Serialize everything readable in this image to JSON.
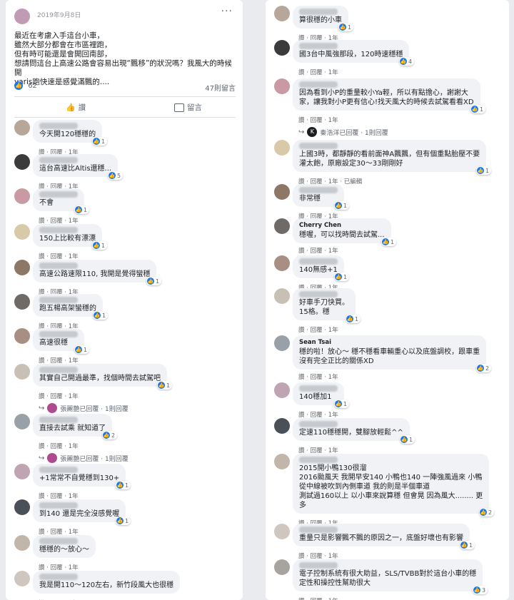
{
  "post": {
    "date": "2019年9月8日",
    "more": "···",
    "body": "最近在考慮入手這台小車，\n雖然大部分都會在市區裡跑，\n但有時可能還是會開回南部，\n想請問這台上高速公路會容易出現“飄移”的狀況嗎？我風大的時候開\nyaris跑快速是感覺滿飄的....",
    "like_count": "62",
    "comment_count": "47則留言",
    "actions": {
      "like": "讚",
      "comment": "留言"
    }
  },
  "colors": {
    "like_blue": "#1877f2",
    "bubble": "#f0f2f5",
    "page_bg": "#e9ebee"
  },
  "icons": {
    "like": "thumb-up-icon",
    "comment": "speech-bubble-icon",
    "more": "ellipsis-icon",
    "reply": "reply-arrow-icon"
  },
  "meta": {
    "like": "讚",
    "reply": "回覆",
    "time": "1年",
    "edited": "已編輯"
  },
  "left_comments": [
    {
      "text": "今天開120穩穩的",
      "reactions": "1"
    },
    {
      "text": "這台高速比Altis還穩...",
      "reactions": "5"
    },
    {
      "text": "不會",
      "reactions": "1"
    },
    {
      "text": "150上比較有漂漂",
      "reactions": "1"
    },
    {
      "text": "高速公路速限110, 我開是覺得蠻穩",
      "reactions": "1"
    },
    {
      "text": "跑五楊高架蠻穩的",
      "reactions": "1"
    },
    {
      "text": "高速很穩",
      "reactions": "1"
    },
    {
      "text": "其實自己開過最準，找個時間去試駕吧",
      "reactions": "1",
      "reply": "張麗艷已回覆 · 1則回覆"
    },
    {
      "text": "直接去試乘 就知道了",
      "reactions": "2",
      "reply": "張麗艷已回覆 · 1則回覆"
    },
    {
      "text": "+1常常不自覺穩到130+",
      "reactions": "1"
    },
    {
      "text": "到140 還是完全沒感覺喔",
      "reactions": "1"
    },
    {
      "text": "穩穩的～放心～",
      "reactions": ""
    },
    {
      "text": "我是開110～120左右，新竹段風大也很穩",
      "reactions": ""
    }
  ],
  "right_comments": [
    {
      "text": "算很穩的小車",
      "reactions": "1"
    },
    {
      "text": "國3台中風強那段，120時速穩穩",
      "reactions": "4"
    },
    {
      "text": "因為看到小P的重量較小Ya輕，所以有點擔心，謝謝大\n家，讓我對小P更有信心!找天風大的時候去試駕看看XD",
      "reactions": "1",
      "reply": "秦浩洋已回覆 · 1則回覆"
    },
    {
      "text": "上國3時，都靜靜的看前面神A飄飄，但有個重點胎壓不要\n灌太飽，原廠設定30～33剛剛好",
      "reactions": "1",
      "edited": true
    },
    {
      "text": "非常穩",
      "reactions": "1"
    },
    {
      "name": "Cherry Chen",
      "text": "穩喔，可以找時間去試駕...",
      "reactions": "1"
    },
    {
      "text": "140無感+1",
      "reactions": "1"
    },
    {
      "text": "好車手刀快買。\n15格。穩",
      "reactions": "1"
    },
    {
      "name": "Sean Tsai",
      "text": "穩的啦！放心～ 穩不穩看車輛重心以及底盤調校，跟車重\n沒有完全正比的關係XD",
      "reactions": "2"
    },
    {
      "text": "140穩加1",
      "reactions": "1"
    },
    {
      "text": "定速110穩穩開，雙腳放輕鬆^^",
      "reactions": "1"
    },
    {
      "text": "2015開小鴨130很溜\n2016颱風天 我開早安140 小鴨也140 一陣強風過來 小鴨\n從中線被吹到內側車道 我的則是半個車道\n測試過160以上 以小車來說算穩 但會晃 因為風大........ 更\n多",
      "reactions": "2"
    },
    {
      "text": "重量只是影響飄不飄的原因之一，底盤好壞也有影響",
      "reactions": "1"
    },
    {
      "text": "電子控制系統有很大助益，SLS/TVBB對於這台小車的穩\n定性和操控性幫助很大",
      "reactions": "3"
    }
  ]
}
